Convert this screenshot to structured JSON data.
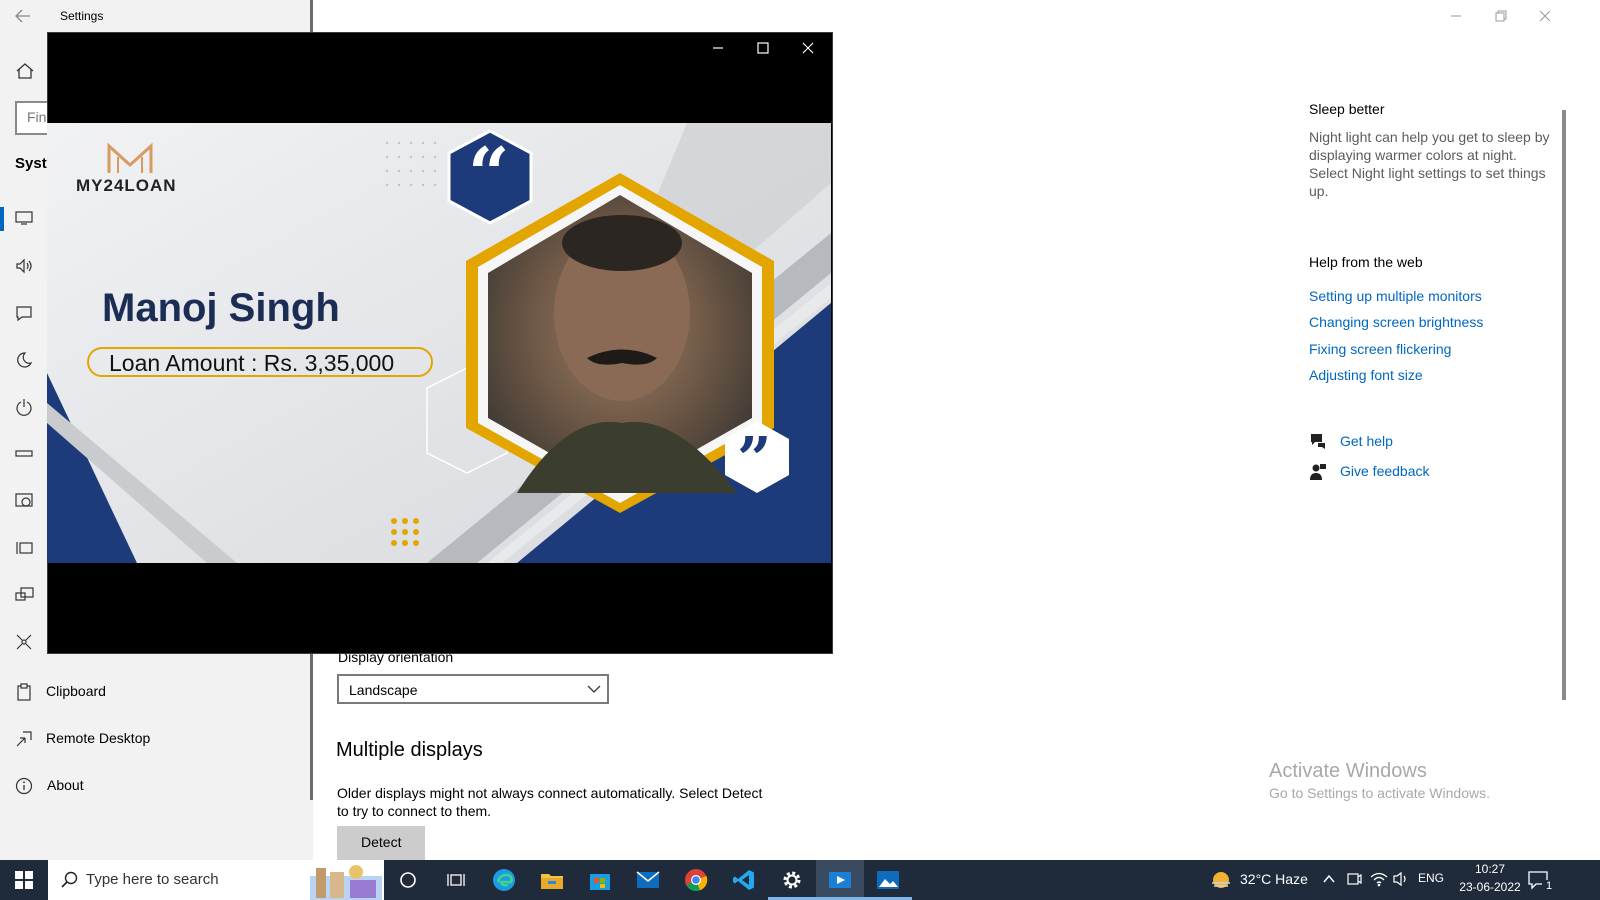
{
  "window": {
    "title": "Settings"
  },
  "nav": {
    "search_placeholder": "Find a setting",
    "section": "System",
    "items": [
      {
        "label": "Clipboard"
      },
      {
        "label": "Remote Desktop"
      },
      {
        "label": "About"
      }
    ]
  },
  "display": {
    "orientation_label": "Display orientation",
    "orientation_value": "Landscape",
    "multiple_title": "Multiple displays",
    "multiple_desc": "Older displays might not always connect automatically. Select Detect to try to connect to them.",
    "detect_label": "Detect"
  },
  "side": {
    "sleep_title": "Sleep better",
    "sleep_desc": "Night light can help you get to sleep by displaying warmer colors at night. Select Night light settings to set things up.",
    "help_title": "Help from the web",
    "links": [
      "Setting up multiple monitors",
      "Changing screen brightness",
      "Fixing screen flickering",
      "Adjusting font size"
    ],
    "get_help": "Get help",
    "give_feedback": "Give feedback"
  },
  "activate": {
    "title": "Activate Windows",
    "subtitle": "Go to Settings to activate Windows."
  },
  "banner": {
    "logo_text": "MY24LOAN",
    "name": "Manoj Singh",
    "loan": "Loan Amount : Rs. 3,35,000"
  },
  "taskbar": {
    "search_placeholder": "Type here to search",
    "weather": "32°C  Haze",
    "language": "ENG",
    "time": "10:27",
    "date": "23-06-2022",
    "notifications": "1"
  },
  "colors": {
    "accent": "#0067c0",
    "banner_blue": "#1d3b7a",
    "banner_gold": "#e3a600",
    "taskbar": "#1f2b3a"
  }
}
